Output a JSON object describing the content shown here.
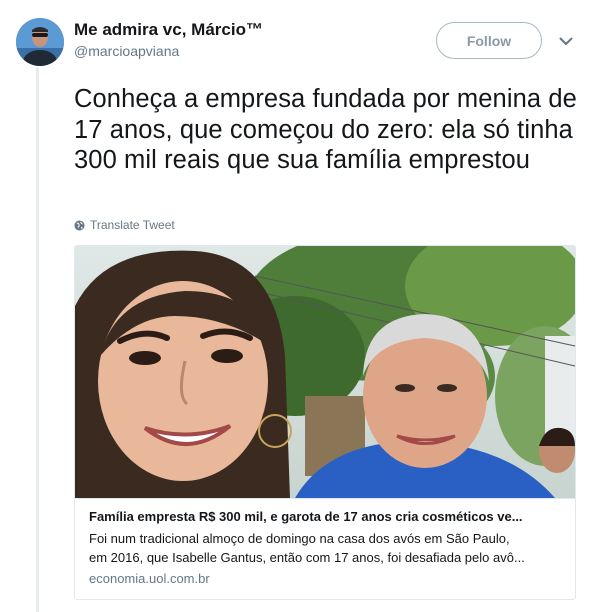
{
  "user": {
    "display_name": "Me admira vc, Márcio™",
    "username": "@marcioapviana"
  },
  "header": {
    "follow_label": "Follow",
    "menu_icon": "chevron-down-icon"
  },
  "tweet": {
    "text": "Conheça a empresa fundada por menina de 17 anos, que começou do zero: ela só tinha 300 mil reais que sua família emprestou",
    "translate_label": "Translate Tweet"
  },
  "card": {
    "title": "Família empresta R$ 300 mil, e garota de 17 anos cria cosméticos ve...",
    "description_line1": "Foi num tradicional almoço de domingo na casa dos avós em São Paulo,",
    "description_line2": "em 2016, que Isabelle Gantus, então com 17 anos, foi desafiada pelo avô...",
    "domain": "economia.uol.com.br"
  },
  "colors": {
    "text": "#14171a",
    "secondary": "#657786",
    "border": "#e1e8ed",
    "follow_border": "#aab8c2"
  }
}
